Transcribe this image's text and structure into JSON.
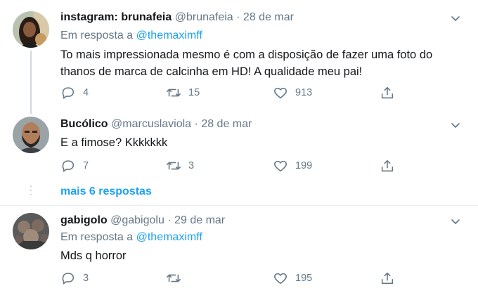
{
  "tweets": [
    {
      "name": "instagram: brunafeia",
      "handle": "@brunafeia",
      "dot": "·",
      "date": "28 de mar",
      "reply_prefix": "Em resposta a",
      "reply_mention": "@themaximff",
      "text": "To mais impressionada mesmo é com a disposição de fazer uma foto do thanos de marca de calcinha em HD! A qualidade meu pai!",
      "replies": "4",
      "retweets": "15",
      "likes": "913"
    },
    {
      "name": "Bucólico",
      "handle": "@marcuslaviola",
      "dot": "·",
      "date": "28 de mar",
      "text": "E a fimose? Kkkkkkk",
      "replies": "7",
      "retweets": "3",
      "likes": "199"
    },
    {
      "name": "gabigolo",
      "handle": "@gabigolu",
      "dot": "·",
      "date": "29 de mar",
      "reply_prefix": "Em resposta a",
      "reply_mention": "@themaximff",
      "text": "Mds q horror",
      "replies": "3",
      "retweets": "",
      "likes": "195"
    }
  ],
  "more_replies": "mais 6 respostas",
  "icons": {
    "reply": "reply-icon",
    "retweet": "retweet-icon",
    "like": "heart-icon",
    "share": "share-icon",
    "caret": "chevron-down-icon"
  },
  "colors": {
    "link": "#1da1f2",
    "muted": "#657786",
    "text": "#14171a"
  }
}
